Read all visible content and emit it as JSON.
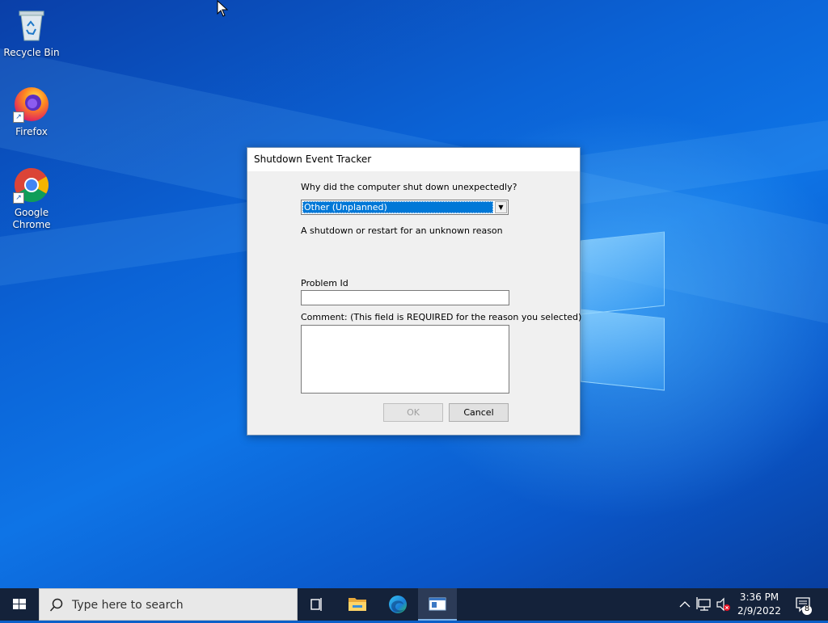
{
  "desktop": {
    "icons": [
      {
        "label": "Recycle Bin",
        "icon": "recycle-bin-icon"
      },
      {
        "label": "Firefox",
        "icon": "firefox-icon"
      },
      {
        "label": "Google Chrome",
        "icon": "chrome-icon"
      }
    ]
  },
  "dialog": {
    "title": "Shutdown Event Tracker",
    "question": "Why did the computer shut down unexpectedly?",
    "reason_selected": "Other (Unplanned)",
    "reason_description": "A shutdown or restart for an unknown reason",
    "problem_id_label": "Problem Id",
    "problem_id_value": "",
    "comment_label": "Comment: (This field is REQUIRED for the reason you selected)",
    "comment_value": "",
    "ok_label": "OK",
    "cancel_label": "Cancel"
  },
  "taskbar": {
    "search_placeholder": "Type here to search",
    "apps": [
      "task-view-icon",
      "file-explorer-icon",
      "edge-icon",
      "active-window-icon"
    ],
    "clock_time": "3:36 PM",
    "clock_date": "2/9/2022",
    "notification_count": "8"
  },
  "colors": {
    "accent": "#0078d7",
    "taskbar": "#14223a"
  }
}
